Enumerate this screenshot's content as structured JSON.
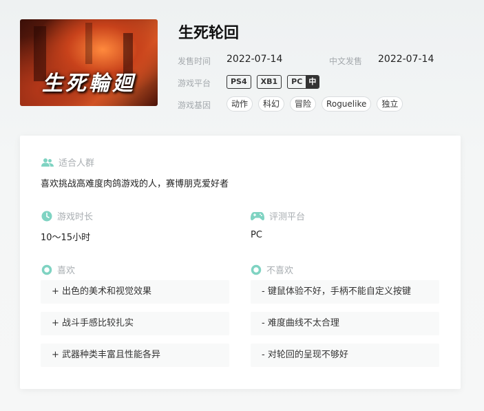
{
  "game": {
    "title": "生死轮回",
    "cover_text": "生死輪廻"
  },
  "meta": {
    "release_label": "发售时间",
    "release_value": "2022-07-14",
    "cn_release_label": "中文发售",
    "cn_release_value": "2022-07-14",
    "platform_label": "游戏平台",
    "platforms": [
      {
        "name": "PS4"
      },
      {
        "name": "XB1"
      },
      {
        "name": "PC",
        "cn_badge": "中"
      }
    ],
    "genre_label": "游戏基因",
    "genres": [
      "动作",
      "科幻",
      "冒险",
      "Roguelike",
      "独立"
    ]
  },
  "review": {
    "audience_label": "适合人群",
    "audience_text": "喜欢挑战高难度肉鸽游戏的人，赛博朋克爱好者",
    "playtime_label": "游戏时长",
    "playtime_text": "10～15小时",
    "platform_label": "评测平台",
    "platform_text": "PC",
    "likes_label": "喜欢",
    "likes": [
      "+ 出色的美术和视觉效果",
      "+ 战斗手感比较扎实",
      "+ 武器种类丰富且性能各异"
    ],
    "dislikes_label": "不喜欢",
    "dislikes": [
      "- 键鼠体验不好，手柄不能自定义按键",
      "- 难度曲线不太合理",
      "- 对轮回的呈现不够好"
    ]
  },
  "colors": {
    "accent": "#7fd3c2",
    "label": "#a9aeb2",
    "item_bg": "#f8f9f9"
  }
}
